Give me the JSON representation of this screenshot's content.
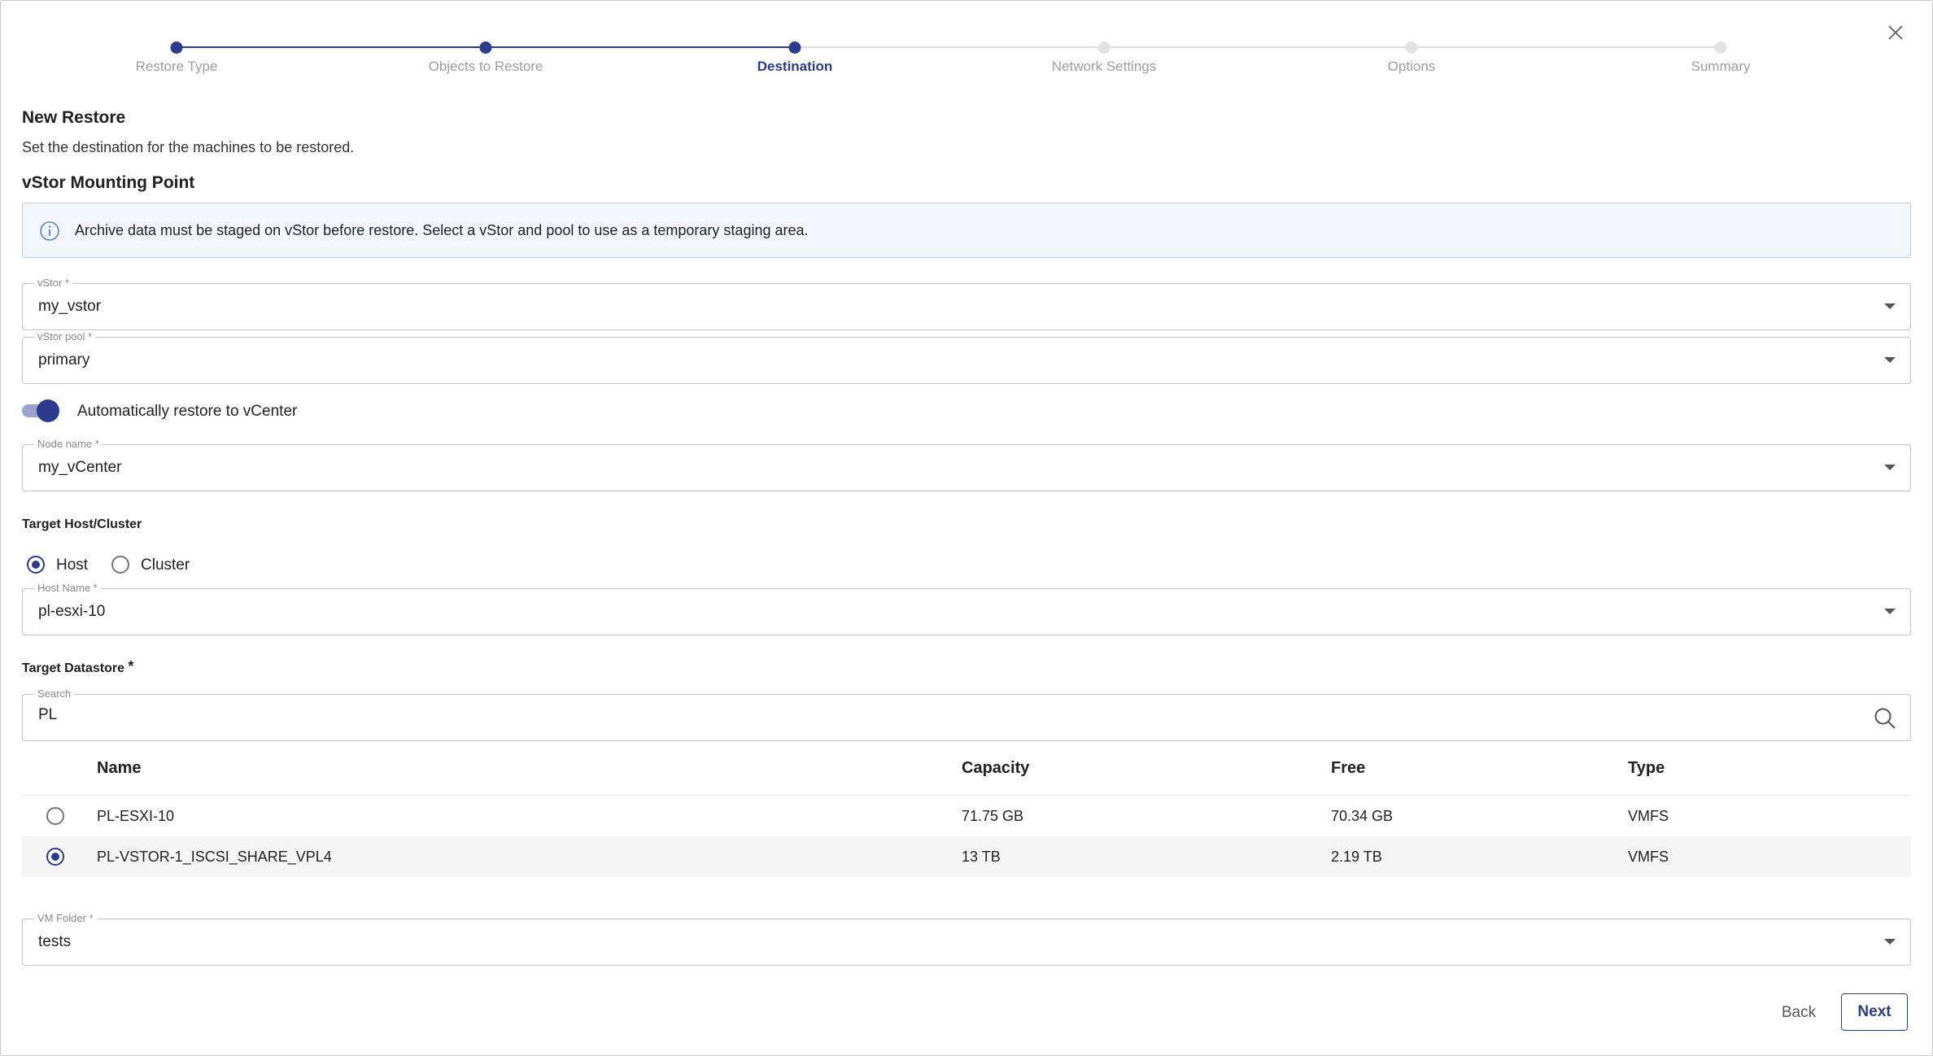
{
  "stepper": {
    "steps": [
      {
        "label": "Restore Type",
        "state": "done"
      },
      {
        "label": "Objects to Restore",
        "state": "done"
      },
      {
        "label": "Destination",
        "state": "active"
      },
      {
        "label": "Network Settings",
        "state": "todo"
      },
      {
        "label": "Options",
        "state": "todo"
      },
      {
        "label": "Summary",
        "state": "todo"
      }
    ]
  },
  "header": {
    "title": "New Restore",
    "subtitle": "Set the destination for the machines to be restored.",
    "section_title": "vStor Mounting Point"
  },
  "info_banner": {
    "icon": "info-icon",
    "text": "Archive data must be staged on vStor before restore. Select a vStor and pool to use as a temporary staging area."
  },
  "fields": {
    "vstor": {
      "label": "vStor *",
      "value": "my_vstor"
    },
    "vstor_pool": {
      "label": "vStor pool *",
      "value": "primary"
    },
    "node_name": {
      "label": "Node name *",
      "value": "my_vCenter"
    },
    "host_name": {
      "label": "Host Name *",
      "value": "pl-esxi-10"
    },
    "vm_folder": {
      "label": "VM Folder *",
      "value": "tests"
    }
  },
  "toggle": {
    "label": "Automatically restore to vCenter",
    "on": true
  },
  "target_host": {
    "title": "Target Host/Cluster",
    "options": [
      {
        "label": "Host",
        "selected": true
      },
      {
        "label": "Cluster",
        "selected": false
      }
    ]
  },
  "datastore": {
    "title": "Target Datastore",
    "required_mark": "*",
    "search": {
      "label": "Search",
      "value": "PL"
    },
    "columns": [
      "Name",
      "Capacity",
      "Free",
      "Type"
    ],
    "rows": [
      {
        "name": "PL-ESXI-10",
        "capacity": "71.75 GB",
        "free": "70.34 GB",
        "type": "VMFS",
        "selected": false
      },
      {
        "name": "PL-VSTOR-1_ISCSI_SHARE_VPL4",
        "capacity": "13 TB",
        "free": "2.19 TB",
        "type": "VMFS",
        "selected": true
      }
    ]
  },
  "footer": {
    "back_label": "Back",
    "next_label": "Next"
  },
  "colors": {
    "accent": "#2d3b8f",
    "info_bg": "#f3f6fd",
    "info_border": "#b9cdf0"
  }
}
